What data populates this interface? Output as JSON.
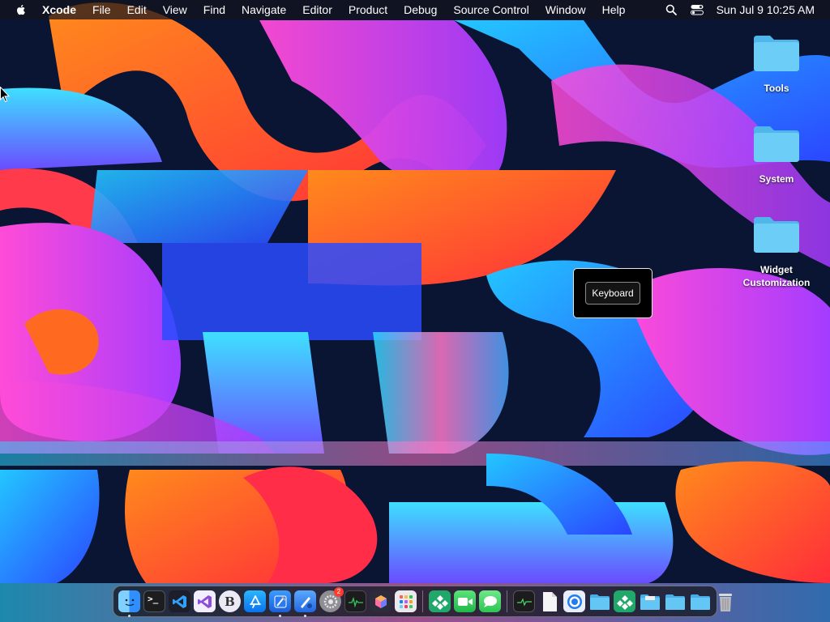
{
  "menubar": {
    "app_name": "Xcode",
    "menus": [
      "File",
      "Edit",
      "View",
      "Find",
      "Navigate",
      "Editor",
      "Product",
      "Debug",
      "Source Control",
      "Window",
      "Help"
    ],
    "clock": "Sun Jul 9  10:25 AM"
  },
  "desktop": {
    "icons": [
      {
        "label": "Tools",
        "icon": "folder-icon"
      },
      {
        "label": "System",
        "icon": "folder-icon"
      },
      {
        "label": "Widget Customization",
        "icon": "folder-icon"
      }
    ]
  },
  "popup": {
    "button_label": "Keyboard"
  },
  "dock": {
    "apps": [
      {
        "icon": "finder-icon",
        "running": true
      },
      {
        "icon": "terminal-icon",
        "running": false
      },
      {
        "icon": "vscode-icon",
        "running": false
      },
      {
        "icon": "visual-studio-icon",
        "running": false
      },
      {
        "icon": "bbedit-icon",
        "running": false,
        "glyph": "B"
      },
      {
        "icon": "app-store-icon",
        "running": false
      },
      {
        "icon": "xcode-icon",
        "running": true
      },
      {
        "icon": "simulator-icon",
        "running": true
      },
      {
        "icon": "system-settings-icon",
        "running": false,
        "badge": "2"
      },
      {
        "icon": "activity-monitor-icon",
        "running": false
      },
      {
        "icon": "reality-composer-icon",
        "running": false
      },
      {
        "icon": "launchpad-icon",
        "running": false
      },
      {
        "icon": "mirror-app-icon",
        "running": false
      },
      {
        "icon": "facetime-icon",
        "running": false
      },
      {
        "icon": "messages-icon",
        "running": false
      },
      {
        "icon": "console-icon",
        "running": false
      },
      {
        "icon": "document-icon",
        "running": false
      },
      {
        "icon": "safari-icon",
        "running": false
      },
      {
        "icon": "folder-icon",
        "running": false
      },
      {
        "icon": "mirror-app-icon",
        "running": false
      },
      {
        "icon": "folder-icon",
        "running": false
      },
      {
        "icon": "folder-icon",
        "running": false
      },
      {
        "icon": "folder-icon",
        "running": false
      },
      {
        "icon": "trash-icon",
        "running": false
      }
    ]
  },
  "colors": {
    "menubar_bg": "#14141c",
    "folder_blue": "#5ec4f2",
    "badge_red": "#ff3b30"
  }
}
